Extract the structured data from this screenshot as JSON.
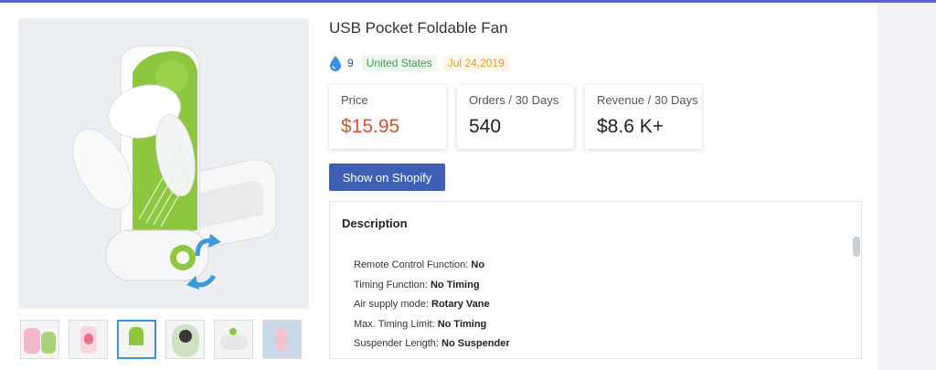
{
  "product": {
    "title": "USB Pocket Foldable Fan",
    "likes": "9",
    "country": "United States",
    "date": "Jul 24,2019"
  },
  "stats": [
    {
      "label": "Price",
      "value": "$15.95"
    },
    {
      "label": "Orders / 30 Days",
      "value": "540"
    },
    {
      "label": "Revenue / 30 Days",
      "value": "$8.6 K+"
    }
  ],
  "actions": {
    "shopify_label": "Show on Shopify"
  },
  "description": {
    "heading": "Description",
    "specs": [
      {
        "label": "Remote Control Function:",
        "value": "No"
      },
      {
        "label": "Timing Function:",
        "value": "No Timing"
      },
      {
        "label": "Air supply mode:",
        "value": "Rotary Vane"
      },
      {
        "label": "Max. Timing Limit:",
        "value": "No Timing"
      },
      {
        "label": "Suspender Length:",
        "value": "No Suspender"
      }
    ]
  },
  "colors": {
    "accent": "#3e60b4",
    "price": "#c9572a",
    "country": "#3c9a52",
    "date": "#e29a2c",
    "fan_green": "#8dc63f"
  }
}
